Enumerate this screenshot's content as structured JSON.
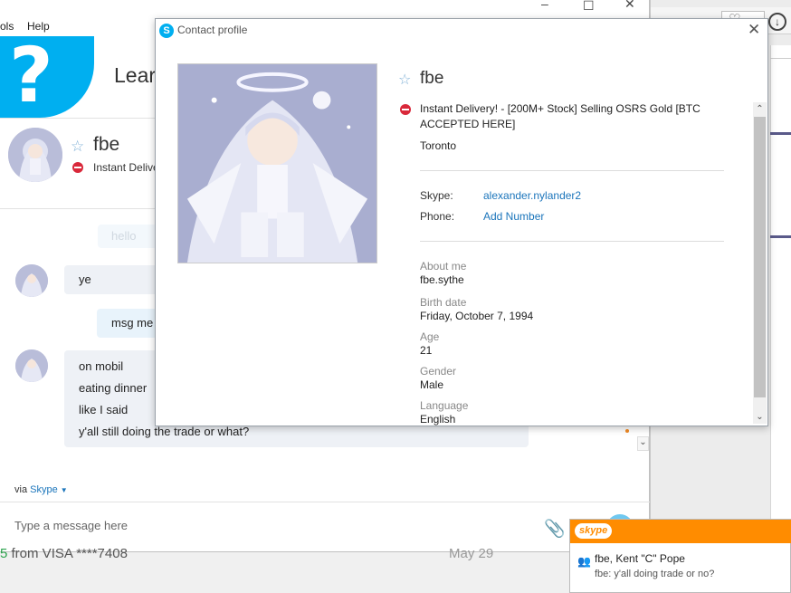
{
  "background_window": {
    "menu": [
      "ols",
      "Help"
    ]
  },
  "main": {
    "learn_text": "Learn",
    "contact": {
      "name": "fbe",
      "mood_partial": "Instant Delive"
    },
    "chat": {
      "hello": "hello",
      "ye": "ye",
      "msg_me": "msg me",
      "lines": [
        "on mobil",
        "eating dinner",
        "like I said",
        "y'all still doing the trade or what?"
      ]
    },
    "via_label": "via",
    "via_link": "Skype",
    "message_placeholder": "Type a message here",
    "visa_row": {
      "amount_prefix": "5",
      "text": "from VISA ****7408",
      "date": "May 29"
    }
  },
  "profile": {
    "title": "Contact profile",
    "name": "fbe",
    "mood": "Instant Delivery! - [200M+ Stock] Selling OSRS Gold [BTC ACCEPTED HERE]",
    "location": "Toronto",
    "skype_key": "Skype:",
    "skype_value": "alexander.nylander2",
    "phone_key": "Phone:",
    "phone_value": "Add Number",
    "about_label": "About me",
    "about_value": "fbe.sythe",
    "birth_label": "Birth date",
    "birth_value": "Friday, October 7, 1994",
    "age_label": "Age",
    "age_value": "21",
    "gender_label": "Gender",
    "gender_value": "Male",
    "language_label": "Language",
    "language_value": "English"
  },
  "toast": {
    "brand": "skype",
    "participants": "fbe, Kent \"C\" Pope",
    "message": "fbe: y'all doing trade or no?"
  },
  "colors": {
    "skype_blue": "#00aff0",
    "link_blue": "#1b75bb",
    "busy_red": "#d9283a",
    "toast_orange": "#ff8c00"
  }
}
